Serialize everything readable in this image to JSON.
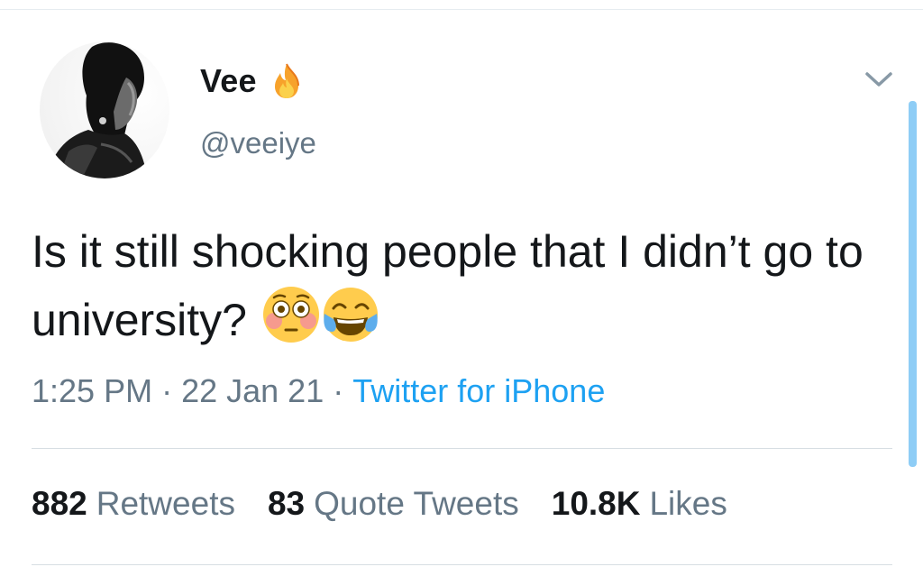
{
  "user": {
    "display_name": "Vee",
    "name_emoji": "fire-icon",
    "handle": "@veeiye",
    "avatar": "avatar"
  },
  "tweet": {
    "text": "Is it still shocking people that I didn’t go to university?",
    "emojis": [
      "flushed-face-icon",
      "tears-of-joy-icon"
    ]
  },
  "meta": {
    "time": "1:25 PM",
    "separator": "·",
    "date": "22 Jan 21",
    "source": "Twitter for iPhone"
  },
  "stats": {
    "retweets_count": "882",
    "retweets_label": "Retweets",
    "quotes_count": "83",
    "quotes_label": "Quote Tweets",
    "likes_count": "10.8K",
    "likes_label": "Likes"
  },
  "colors": {
    "link": "#1da1f2",
    "secondary_text": "#657786",
    "primary_text": "#14171a"
  }
}
